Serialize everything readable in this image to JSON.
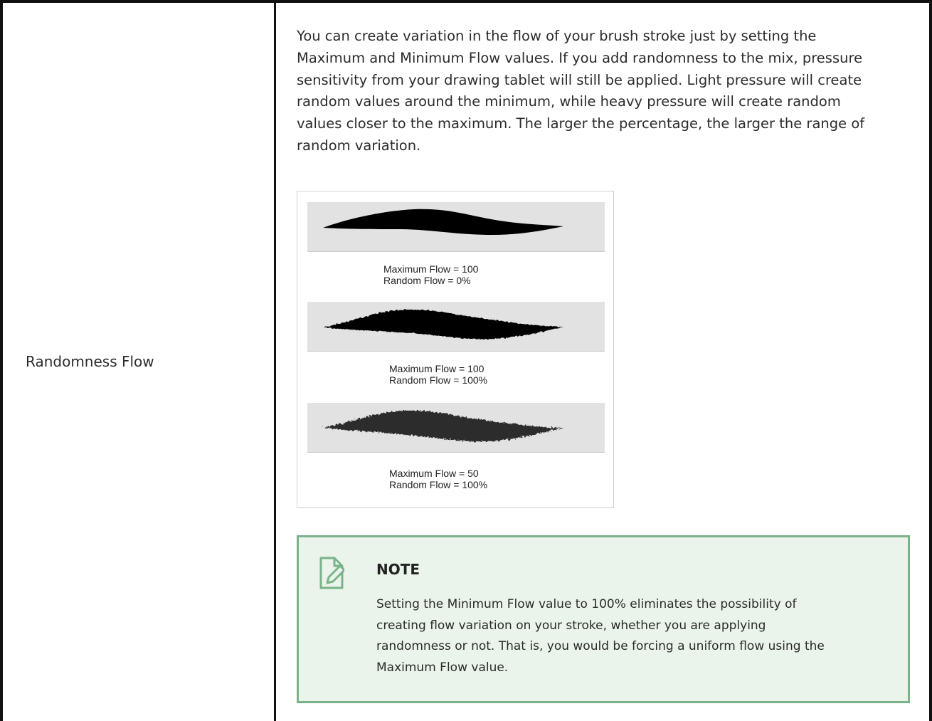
{
  "row": {
    "label": "Randomness Flow"
  },
  "description": {
    "lines": [
      "You can create variation in the flow of your brush stroke just by setting the",
      "Maximum and Minimum Flow values. If you add randomness to the mix, pressure",
      "sensitivity from your drawing tablet will still be applied. Light pressure will create",
      "random values around the minimum, while heavy pressure will create random",
      "values closer to the maximum. The larger the percentage, the larger the range of",
      "random variation."
    ]
  },
  "figure": {
    "samples": [
      {
        "line1": "Maximum Flow = 100",
        "line2": "Random Flow = 0%",
        "max_flow": 100,
        "random_flow": 0
      },
      {
        "line1": "Maximum Flow = 100",
        "line2": "Random Flow = 100%",
        "max_flow": 100,
        "random_flow": 100
      },
      {
        "line1": "Maximum Flow = 50",
        "line2": "Random Flow = 100%",
        "max_flow": 50,
        "random_flow": 100
      }
    ]
  },
  "note": {
    "icon": "note-pencil-icon",
    "title": "NOTE",
    "lines": [
      "Setting the Minimum Flow value to 100% eliminates the possibility of",
      "creating flow variation on your stroke, whether you are applying",
      "randomness or not. That is, you would be forcing a uniform flow using the",
      "Maximum Flow value."
    ]
  },
  "colors": {
    "note_border": "#7ab389",
    "note_background": "#eaf4ea",
    "table_border": "#111111"
  }
}
